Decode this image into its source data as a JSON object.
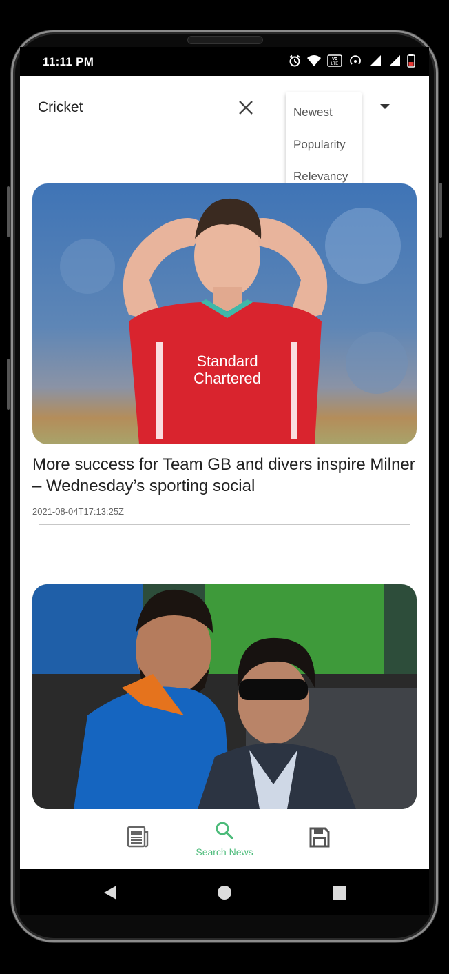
{
  "status_bar": {
    "time": "11:11 PM",
    "icons": [
      "alarm-icon",
      "wifi-icon",
      "volte-icon",
      "hotspot-icon",
      "signal-icon",
      "signal-icon",
      "battery-icon"
    ]
  },
  "search": {
    "query": "Cricket",
    "clear_icon": "close-icon"
  },
  "sort_menu": {
    "options": [
      "Newest",
      "Popularity",
      "Relevancy"
    ],
    "dropdown_icon": "caret-down-icon"
  },
  "articles": [
    {
      "title": "More success for Team GB and divers inspire Milner – Wednesday’s sporting social",
      "published_at": "2021-08-04T17:13:25Z",
      "image": "footballer-in-red-jersey-hands-on-head"
    },
    {
      "title": "",
      "published_at": "",
      "image": "two-cricketers-smiling"
    }
  ],
  "bottom_nav": {
    "items": [
      {
        "label": "",
        "icon": "newspaper-icon",
        "active": false
      },
      {
        "label": "Search News",
        "icon": "search-icon",
        "active": true
      },
      {
        "label": "",
        "icon": "save-icon",
        "active": false
      }
    ]
  },
  "system_nav": {
    "icons": [
      "back-icon",
      "home-icon",
      "recents-icon"
    ]
  },
  "colors": {
    "accent": "#4cbb7a",
    "text": "#222222",
    "muted": "#666666"
  }
}
